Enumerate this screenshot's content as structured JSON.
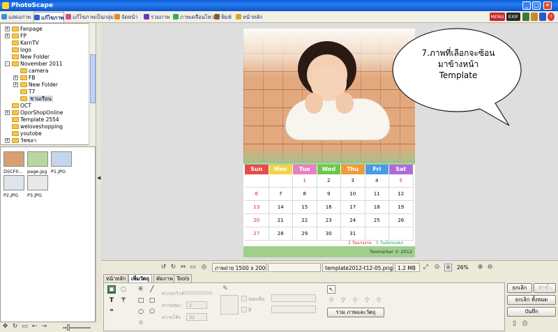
{
  "window": {
    "title": "PhotoScape"
  },
  "menu_tabs": [
    {
      "label": "แสดงภาพ",
      "color": "#3b8fd8"
    },
    {
      "label": "แก้ไขภาพ",
      "color": "#2a62c8",
      "active": true
    },
    {
      "label": "แก้ไขภาพเป็นกลุ่ม",
      "color": "#d84b8a"
    },
    {
      "label": "จัดหน้า",
      "color": "#e88a2a"
    },
    {
      "label": "รวมภาพ",
      "color": "#6a3ab8"
    },
    {
      "label": "ภาพเคลื่อนไหว",
      "color": "#3aa85a"
    },
    {
      "label": "พิมพ์",
      "color": "#8a5a2a"
    },
    {
      "label": "หน้าหลัก",
      "color": "#d8a82a"
    }
  ],
  "right_badges": [
    "MENU",
    "EXIF"
  ],
  "tree": [
    {
      "label": "Fanpage",
      "indent": 1,
      "exp": "+"
    },
    {
      "label": "FP",
      "indent": 1,
      "exp": "+"
    },
    {
      "label": "KarnTV",
      "indent": 1,
      "exp": ""
    },
    {
      "label": "logo",
      "indent": 1,
      "exp": ""
    },
    {
      "label": "New Folder",
      "indent": 1,
      "exp": ""
    },
    {
      "label": "November 2011",
      "indent": 1,
      "exp": "-"
    },
    {
      "label": "camera",
      "indent": 2,
      "exp": ""
    },
    {
      "label": "FB",
      "indent": 2,
      "exp": "+"
    },
    {
      "label": "New Folder",
      "indent": 2,
      "exp": "+"
    },
    {
      "label": "T7",
      "indent": 2,
      "exp": ""
    },
    {
      "label": "ชานเรือน",
      "indent": 2,
      "exp": "",
      "selected": true
    },
    {
      "label": "OCT",
      "indent": 1,
      "exp": ""
    },
    {
      "label": "OporShopOnline",
      "indent": 1,
      "exp": "+"
    },
    {
      "label": "Template 2554",
      "indent": 1,
      "exp": ""
    },
    {
      "label": "weloveshopping",
      "indent": 1,
      "exp": ""
    },
    {
      "label": "youtobe",
      "indent": 1,
      "exp": ""
    },
    {
      "label": "วัชชลา",
      "indent": 1,
      "exp": "+"
    },
    {
      "label": "เวิร์ดเรือน",
      "indent": 1,
      "exp": "+"
    }
  ],
  "thumbnails": [
    {
      "label": "DSCF0...",
      "color": "#d8a070"
    },
    {
      "label": "page.jpg",
      "color": "#b9d6a0"
    },
    {
      "label": "P1.JPG",
      "color": "#c6d6ea"
    },
    {
      "label": "P2.JPG",
      "color": "#dfe4ec"
    },
    {
      "label": "P3.JPG",
      "color": "#e8e8ea"
    }
  ],
  "calendar": {
    "days": [
      "Sun",
      "Mon",
      "Tue",
      "Wed",
      "Thu",
      "Fri",
      "Sat"
    ],
    "day_colors": [
      "#e84a4a",
      "#f0d44a",
      "#e880c0",
      "#6ac84a",
      "#f09a3a",
      "#4a9ae8",
      "#b06ad8"
    ],
    "weeks": [
      [
        "",
        "",
        "1",
        "2",
        "3",
        "4",
        "5"
      ],
      [
        "6",
        "7",
        "8",
        "9",
        "10",
        "11",
        "12"
      ],
      [
        "13",
        "14",
        "15",
        "16",
        "17",
        "18",
        "19"
      ],
      [
        "20",
        "21",
        "22",
        "23",
        "24",
        "25",
        "26"
      ],
      [
        "27",
        "28",
        "29",
        "30",
        "31",
        "",
        ""
      ]
    ],
    "red_days": [
      "1",
      "5",
      "6",
      "13",
      "20",
      "27"
    ],
    "legend_1": "1 วันแรงงาน",
    "legend_2": "5 วันฉัตรมงคล",
    "signature": "Toomarker © 2012"
  },
  "callout": {
    "line1": "7.ภาพที่เลือกจะซ้อน",
    "line2": "มาข้างหน้า",
    "line3": "Template"
  },
  "status": {
    "image_size": "ภาพถ่าย 1500 x 2000",
    "filename": "template2012-t12-05.png",
    "filesize": "1.2 MB",
    "zoom": "26%"
  },
  "edit_tabs": [
    "หน้าหลัก",
    "เพิ่มวัตถุ",
    "ตัดภาพ",
    "Tools"
  ],
  "edit_labels": {
    "line_width": "ความกว้าง",
    "thickness": "ความหนา",
    "radius": "ความโค้ง",
    "thickness_val": "2",
    "radius_val": "32",
    "border_label": "ขอบเส้น",
    "fill_label": "สี",
    "merge_button": "รวม ภาพและวัตถุ"
  },
  "right_buttons": {
    "undo": "ยกเลิก",
    "redo": "ทำซ้ำ",
    "undo_all": "ยกเลิก ทั้งหมด",
    "save": "บันทึก"
  }
}
